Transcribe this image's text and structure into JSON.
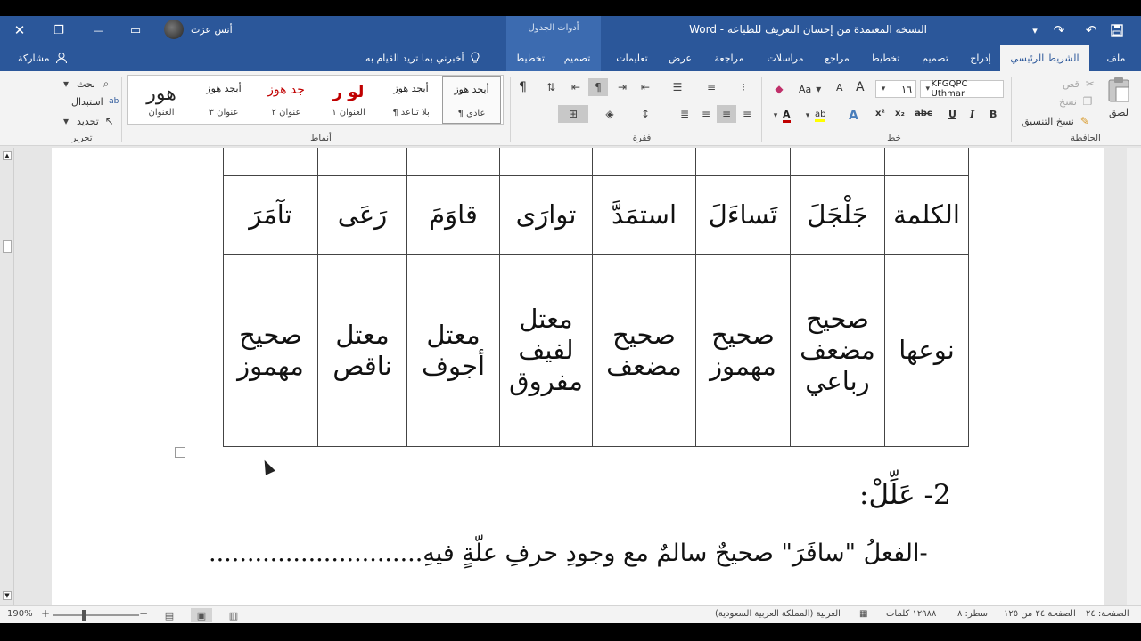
{
  "window": {
    "title": "النسخة المعتمدة من إحسان التعريف للطباعة  -  Word",
    "context_tab_group": "أدوات الجدول",
    "user_name": "أنس عزت",
    "close_symbol": "✕",
    "restore_symbol": "❐",
    "minimize_symbol": "—",
    "ribbon_display_symbol": "▭"
  },
  "qat": {
    "save_icon": "save-icon",
    "redo_symbol": "↷",
    "undo_symbol": "↶",
    "customize_symbol": "▾"
  },
  "tabs": {
    "file": "ملف",
    "home": "الشريط الرئيسي",
    "insert": "إدراج",
    "design": "تصميم",
    "layout": "تخطيط",
    "references": "مراجع",
    "mailings": "مراسلات",
    "review": "مراجعة",
    "view": "عرض",
    "help": "تعليمات",
    "table_design": "تصميم",
    "table_layout": "تخطيط",
    "tell_me": "أخبرني بما تريد القيام به",
    "share": "مشاركة"
  },
  "ribbon": {
    "clipboard": {
      "label": "الحافظة",
      "paste": "لصق",
      "cut": "قص",
      "copy": "نسخ",
      "format_painter": "نسخ التنسيق"
    },
    "font": {
      "label": "خط",
      "font_name": "KFGQPC Uthmar",
      "font_size": "١٦",
      "bold": "B",
      "italic": "I",
      "underline": "U",
      "strike": "abc",
      "subscript": "x₂",
      "superscript": "x²",
      "text_effects": "A",
      "highlight": "ab",
      "font_color": "A",
      "grow": "A",
      "shrink": "A",
      "change_case": "Aa"
    },
    "paragraph": {
      "label": "فقرة",
      "pilcrow": "¶"
    },
    "styles": {
      "label": "أنماط",
      "items": [
        {
          "sample": "أبجد هوز",
          "name": "¶ عادي"
        },
        {
          "sample": "أبجد هوز",
          "name": "¶ بلا تباعد"
        },
        {
          "sample": "ﻟﻮ ﺭ",
          "name": "العنوان ١"
        },
        {
          "sample": "جد هوز",
          "name": "عنوان ٢"
        },
        {
          "sample": "أبجد هوز",
          "name": "عنوان ٣"
        },
        {
          "sample": "هور",
          "name": "العنوان"
        }
      ]
    },
    "editing": {
      "label": "تحرير",
      "find": "بحث",
      "replace": "استبدال",
      "select": "تحديد"
    }
  },
  "table": {
    "word_header": "الكلمة",
    "type_header": "نوعها",
    "words": [
      "جَلْجَلَ",
      "تَساءَلَ",
      "استمَدَّ",
      "توارَى",
      "قاوَمَ",
      "رَعَى",
      "تآمَرَ"
    ],
    "types": [
      [
        "صحيح",
        "مضعف",
        "رباعي"
      ],
      [
        "صحيح",
        "مهموز"
      ],
      [
        "صحيح",
        "مضعف"
      ],
      [
        "معتل",
        "لفيف",
        "مفروق"
      ],
      [
        "معتل",
        "أجوف"
      ],
      [
        "معتل",
        "ناقص"
      ],
      [
        "صحيح",
        "مهموز"
      ]
    ]
  },
  "document": {
    "question_title": "2- عَلِّلْ:",
    "question_line": "-الفعلُ \"سافَرَ\" صحيحٌ سالمٌ مع وجودِ حرفِ علّةٍ فيهِ............................"
  },
  "status": {
    "page": "الصفحة: ٢٤",
    "section": "الصفحة ٢٤ من ١٢٥",
    "line": "سطر: ٨",
    "words": "١٢٩٨٨ كلمات",
    "language": "العربية (المملكة العربية السعودية)",
    "zoom": "190%",
    "zoom_minus": "−",
    "zoom_plus": "+"
  },
  "colors": {
    "accent": "#2b579a",
    "context_tab": "#3c6bb0",
    "ribbon_bg": "#f3f3f3",
    "heading_red": "#c00000"
  }
}
